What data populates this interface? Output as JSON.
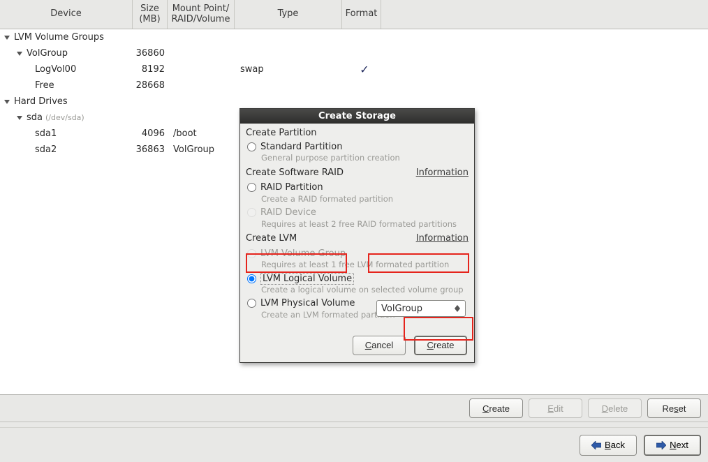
{
  "columns": {
    "device": "Device",
    "size": "Size\n(MB)",
    "mount": "Mount Point/\nRAID/Volume",
    "type": "Type",
    "format": "Format"
  },
  "tree": {
    "lvm_group_header": "LVM Volume Groups",
    "volgroup": {
      "name": "VolGroup",
      "size": "36860"
    },
    "logvol": {
      "name": "LogVol00",
      "size": "8192",
      "type": "swap"
    },
    "free": {
      "name": "Free",
      "size": "28668"
    },
    "hd_header": "Hard Drives",
    "sda": {
      "name": "sda",
      "sub": "(/dev/sda)"
    },
    "sda1": {
      "name": "sda1",
      "size": "4096",
      "mount": "/boot"
    },
    "sda2": {
      "name": "sda2",
      "size": "36863",
      "mount": "VolGroup"
    }
  },
  "dialog": {
    "title": "Create Storage",
    "sec_part": "Create Partition",
    "std_part": "Standard Partition",
    "std_part_hint": "General purpose partition creation",
    "sec_raid": "Create Software RAID",
    "info": "Information",
    "raid_part": "RAID Partition",
    "raid_part_hint": "Create a RAID formated partition",
    "raid_dev": "RAID Device",
    "raid_dev_hint": "Requires at least 2 free RAID formated partitions",
    "sec_lvm": "Create LVM",
    "lvm_vg": "LVM Volume Group",
    "lvm_vg_hint": "Requires at least 1 free LVM formated partition",
    "lvm_lv": "LVM Logical Volume",
    "lvm_lv_hint": "Create a logical volume on selected volume group",
    "lvm_pv": "LVM Physical Volume",
    "lvm_pv_hint": "Create an LVM formated partition",
    "select_value": "VolGroup",
    "cancel": "Cancel",
    "create": "Create"
  },
  "actions": {
    "create": "Create",
    "edit": "Edit",
    "delete": "Delete",
    "reset": "Reset"
  },
  "nav": {
    "back": "Back",
    "next": "Next"
  }
}
